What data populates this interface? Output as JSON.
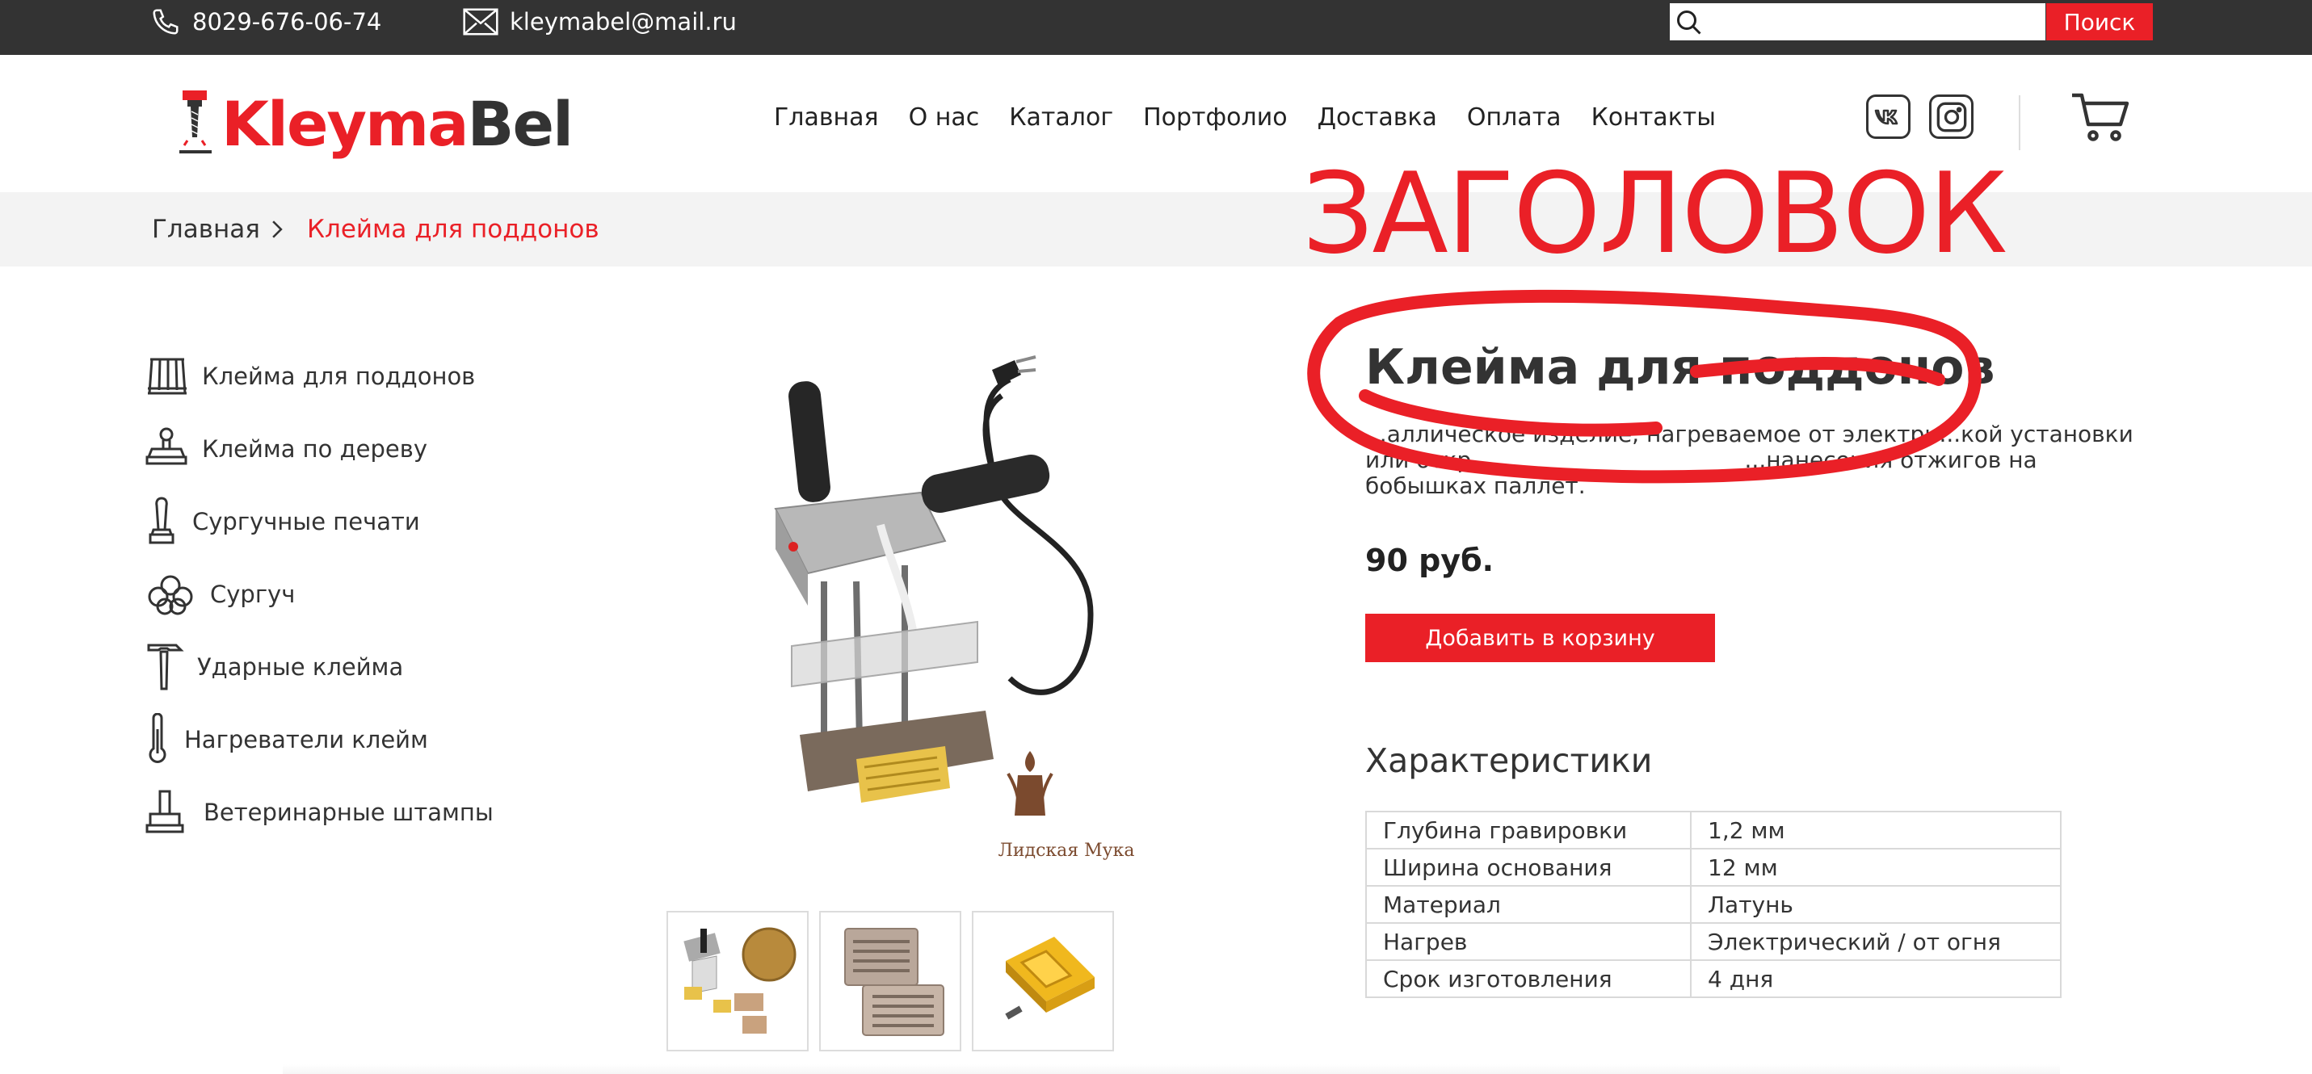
{
  "topbar": {
    "phone": "8029-676-06-74",
    "email": "kleymabel@mail.ru",
    "search_placeholder": "",
    "search_button": "Поиск"
  },
  "logo": {
    "part1": "Kleyma",
    "part2": "Bel"
  },
  "nav": [
    "Главная",
    "О нас",
    "Каталог",
    "Портфолио",
    "Доставка",
    "Оплата",
    "Контакты"
  ],
  "social": {
    "vk": "VK",
    "instagram": "Instagram"
  },
  "breadcrumb": {
    "home": "Главная",
    "current": "Клейма для поддонов"
  },
  "sidebar": [
    {
      "label": "Клейма для поддонов",
      "icon": "pallet-icon"
    },
    {
      "label": "Клейма по дереву",
      "icon": "stamp-icon"
    },
    {
      "label": "Сургучные печати",
      "icon": "seal-icon"
    },
    {
      "label": "Сургуч",
      "icon": "wax-icon"
    },
    {
      "label": "Ударные клейма",
      "icon": "hammer-icon"
    },
    {
      "label": "Нагреватели клейм",
      "icon": "thermometer-icon"
    },
    {
      "label": "Ветеринарные штампы",
      "icon": "vet-stamp-icon"
    }
  ],
  "annotation": {
    "title": "ЗАГОЛОВОК"
  },
  "product": {
    "title": "Клейма для поддонов",
    "description_line1": "...аллическое изделие, нагреваемое от электри...кой установки",
    "description_line2": "или откр...                                   ...нанесения отжигов на",
    "description_line3": "бобышках паллет.",
    "image_watermark": "Лидская Мука",
    "price": "90 руб.",
    "add_to_cart": "Добавить в корзину"
  },
  "specs": {
    "title": "Характеристики",
    "rows": [
      {
        "key": "Глубина гравировки",
        "value": "1,2 мм"
      },
      {
        "key": "Ширина основания",
        "value": "12 мм"
      },
      {
        "key": "Материал",
        "value": "Латунь"
      },
      {
        "key": "Нагрев",
        "value": "Электрический / от огня"
      },
      {
        "key": "Срок изготовления",
        "value": "4 дня"
      }
    ]
  },
  "colors": {
    "accent": "#ea2027",
    "topbar": "#333333",
    "breadcrumb_bg": "#f3f3f3",
    "annotation": "#ea2027"
  }
}
